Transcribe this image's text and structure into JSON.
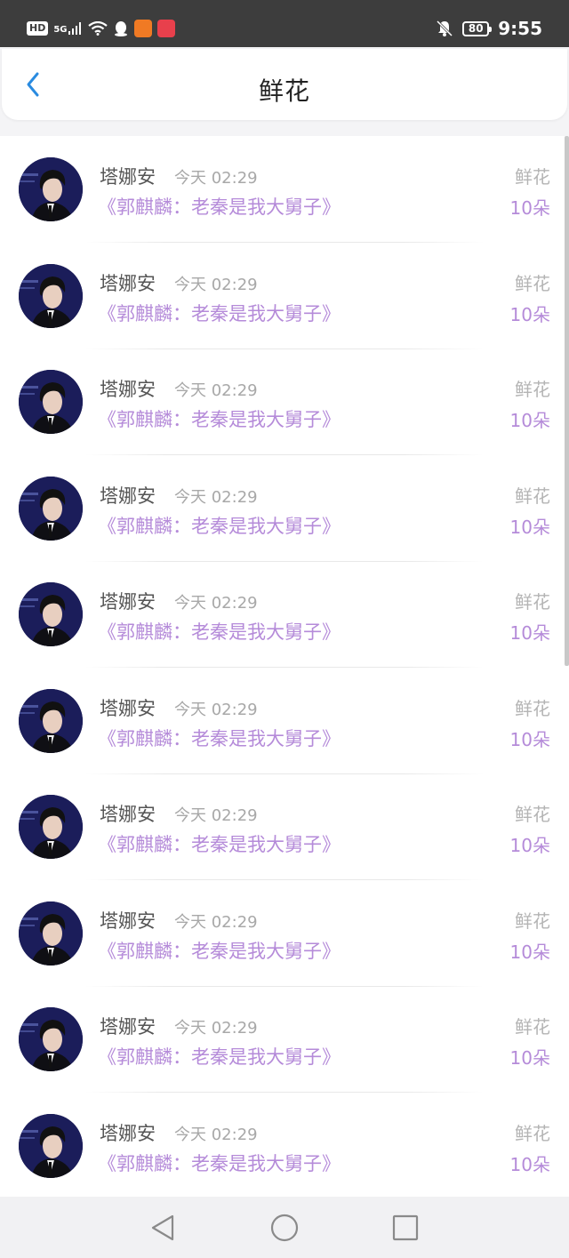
{
  "status_bar": {
    "network_badge": "HD",
    "signal_label": "5G",
    "battery": "80",
    "time": "9:55"
  },
  "header": {
    "title": "鲜花",
    "back_icon": "chevron-left-icon"
  },
  "colors": {
    "accent_blue": "#2a8be0",
    "accent_purple": "#b58bd9"
  },
  "gift_list": [
    {
      "name": "塔娜安",
      "time": "今天 02:29",
      "book": "《郭麒麟：老秦是我大舅子》",
      "gift_type": "鲜花",
      "gift_amount": "10朵"
    },
    {
      "name": "塔娜安",
      "time": "今天 02:29",
      "book": "《郭麒麟：老秦是我大舅子》",
      "gift_type": "鲜花",
      "gift_amount": "10朵"
    },
    {
      "name": "塔娜安",
      "time": "今天 02:29",
      "book": "《郭麒麟：老秦是我大舅子》",
      "gift_type": "鲜花",
      "gift_amount": "10朵"
    },
    {
      "name": "塔娜安",
      "time": "今天 02:29",
      "book": "《郭麒麟：老秦是我大舅子》",
      "gift_type": "鲜花",
      "gift_amount": "10朵"
    },
    {
      "name": "塔娜安",
      "time": "今天 02:29",
      "book": "《郭麒麟：老秦是我大舅子》",
      "gift_type": "鲜花",
      "gift_amount": "10朵"
    },
    {
      "name": "塔娜安",
      "time": "今天 02:29",
      "book": "《郭麒麟：老秦是我大舅子》",
      "gift_type": "鲜花",
      "gift_amount": "10朵"
    },
    {
      "name": "塔娜安",
      "time": "今天 02:29",
      "book": "《郭麒麟：老秦是我大舅子》",
      "gift_type": "鲜花",
      "gift_amount": "10朵"
    },
    {
      "name": "塔娜安",
      "time": "今天 02:29",
      "book": "《郭麒麟：老秦是我大舅子》",
      "gift_type": "鲜花",
      "gift_amount": "10朵"
    },
    {
      "name": "塔娜安",
      "time": "今天 02:29",
      "book": "《郭麒麟：老秦是我大舅子》",
      "gift_type": "鲜花",
      "gift_amount": "10朵"
    },
    {
      "name": "塔娜安",
      "time": "今天 02:29",
      "book": "《郭麒麟：老秦是我大舅子》",
      "gift_type": "鲜花",
      "gift_amount": "10朵"
    }
  ],
  "nav_bar": {
    "back_icon": "triangle-back-icon",
    "home_icon": "circle-home-icon",
    "recents_icon": "square-recents-icon"
  }
}
